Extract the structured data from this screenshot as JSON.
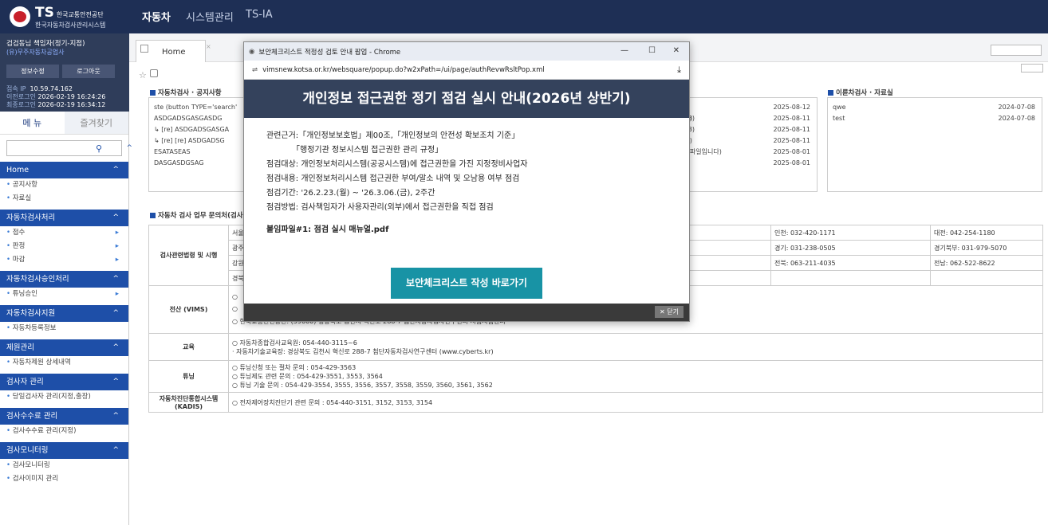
{
  "brand": {
    "logo_text": "TS",
    "org_name": "한국교통안전공단",
    "system_name": "한국자동차검사관리시스템"
  },
  "topnav": {
    "items": [
      "자동차",
      "시스템관리",
      "TS-IA"
    ]
  },
  "user": {
    "title": "검검동님 책임자(정기-지점)",
    "company": "(유)무주자동차공업사",
    "edit_label": "정보수정",
    "logout_label": "로그아웃",
    "ip_label": "접속 IP",
    "ip_value": "10.59.74.162",
    "prev_login_label": "이전로그인",
    "prev_login_value": "2026-02-19 16:24:26",
    "last_login_label": "최종로그인",
    "last_login_value": "2026-02-19 16:34:12"
  },
  "sidebar": {
    "tab_menu": "메 뉴",
    "tab_fav": "즐겨찾기",
    "sections": [
      {
        "title": "Home",
        "items": [
          {
            "label": "공지사항",
            "arrow": false
          },
          {
            "label": "자료실",
            "arrow": false
          }
        ]
      },
      {
        "title": "자동차검사처리",
        "items": [
          {
            "label": "접수",
            "arrow": true
          },
          {
            "label": "판정",
            "arrow": true
          },
          {
            "label": "마감",
            "arrow": true
          }
        ]
      },
      {
        "title": "자동차검사승인처리",
        "items": [
          {
            "label": "튜닝승인",
            "arrow": true
          }
        ]
      },
      {
        "title": "자동차검사지원",
        "items": [
          {
            "label": "자동차등록정보",
            "arrow": false
          }
        ]
      },
      {
        "title": "제원관리",
        "items": [
          {
            "label": "자동차제원 상세내역",
            "arrow": false
          }
        ]
      },
      {
        "title": "검사자 관리",
        "items": [
          {
            "label": "당일검사자 관리(지정,출장)",
            "arrow": false
          }
        ]
      },
      {
        "title": "검사수수료 관리",
        "items": [
          {
            "label": "검사수수료 관리(지정)",
            "arrow": false
          }
        ]
      },
      {
        "title": "검사모니터링",
        "items": [
          {
            "label": "검사모니터링",
            "arrow": false
          },
          {
            "label": "검사이미지 관리",
            "arrow": false
          }
        ]
      }
    ]
  },
  "main": {
    "tab_home": "Home",
    "notice_title": "자동차검사 · 공지사항",
    "notices": [
      {
        "title": "ste (button TYPE='search'",
        "date": "2025-08-12"
      },
      {
        "title": "ASDGADSGASGASDG",
        "date": "2025-08-11"
      },
      {
        "title": "↳ [re] ASDGADSGASGA",
        "date": "2025-08-11"
      },
      {
        "title": "↳ [re] [re] ASDGADSG",
        "date": "2025-08-11"
      },
      {
        "title": "ESATASEAS",
        "date": "2025-08-01"
      },
      {
        "title": "DASGASDGSAG",
        "date": "2025-08-01"
      }
    ],
    "notice_mid": [
      "/3)",
      "(/3)",
      "(/3)",
      "/3)",
      "df파일입니다)"
    ],
    "ref_title": "이륜차검사 · 자료실",
    "refs": [
      {
        "title": "qwe",
        "date": "2024-07-08"
      },
      {
        "title": "test",
        "date": "2024-07-08"
      }
    ],
    "contact_title": "자동차 검사 업무 문의처(검사",
    "contacts": {
      "law_label": "검사관련법령 및 시행",
      "regions_left": [
        "서울",
        "광주",
        "강원",
        "경북"
      ],
      "regions_right": [
        [
          "인천: 032-420-1171",
          "대전: 042-254-1180"
        ],
        [
          "경기: 031-238-0505",
          "경기북부: 031-979-5070"
        ],
        [
          "전북: 063-211-4035",
          "전남: 062-522-8622"
        ],
        [
          "",
          ""
        ]
      ],
      "vims_label": "전산 (VIMS)",
      "vims_lines": [
        "○",
        "○",
        "○ 한국교통안전공단: (39660) 경상북도 김천시 혁신로 288-7 첨단자동차검사연구센터 시험시험센터"
      ],
      "edu_label": "교육",
      "edu_lines": [
        "○ 자동차종합검사교육원: 054-440-3115~6",
        "· 자동차기술교육장: 경상북도 김천시 혁신로 288-7 첨단자동차검사연구센터 (www.cyberts.kr)"
      ],
      "tuning_label": "튜닝",
      "tuning_lines": [
        "○ 튜닝신청 또는 절차 문의 : 054-429-3563",
        "○ 튜닝제도 관련 문의 : 054-429-3551, 3553, 3564",
        "○ 튜닝 기술 문의 : 054-429-3554, 3555, 3556, 3557, 3558, 3559, 3560, 3561, 3562"
      ],
      "kadis_label": "자동차진단통합시스템 (KADIS)",
      "kadis_lines": [
        "○ 전자제어장치진단기 관련 문의 : 054-440-3151, 3152, 3153, 3154"
      ]
    }
  },
  "popup": {
    "window_title": "보안체크리스트 적정성 검토 안내 팝업 - Chrome",
    "address": "vimsnew.kotsa.or.kr/websquare/popup.do?w2xPath=/ui/page/authRevwRsltPop.xml",
    "heading": "개인정보 접근권한 정기 점검 실시 안내(2026년 상반기)",
    "lines": [
      "관련근거:「개인정보보호법」제00조,「개인정보의 안전성 확보조치 기준」",
      "「행정기관 정보시스템 접근권한 관리 규정」",
      "점검대상: 개인정보처리시스템(공공시스템)에 접근권한을 가진 지정정비사업자",
      "점검내용: 개인정보처리시스템 접근권한 부여/말소 내역 및 오남용 여부 점검",
      "점검기간: '26.2.23.(월) ~ '26.3.06.(금), 2주간",
      "점검방법: 검사책임자가 사용자관리(외부)에서 접근권한을 직접 점검"
    ],
    "attachment": "붙임파일#1: 점검 실시 매뉴얼.pdf",
    "button_label": "보안체크리스트 작성 바로가기",
    "close_label": "✕ 닫기"
  },
  "colors": {
    "topbar": "#1e2f55",
    "section": "#1e4fa8",
    "popup_head": "#34425c",
    "popup_button": "#1893a5"
  }
}
